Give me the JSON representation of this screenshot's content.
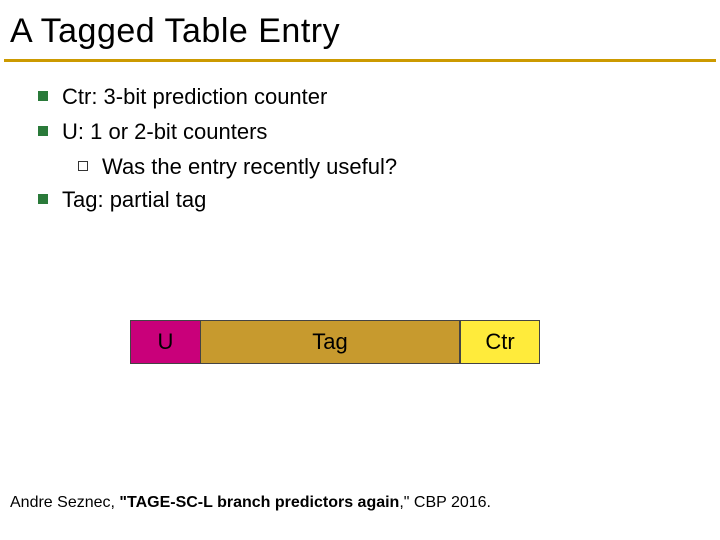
{
  "title": "A Tagged Table Entry",
  "bullets": [
    {
      "text": "Ctr: 3-bit prediction counter"
    },
    {
      "text": "U:   1 or  2-bit counters",
      "sub": [
        {
          "text": "Was the entry recently useful?"
        }
      ]
    },
    {
      "text": "Tag: partial tag"
    }
  ],
  "diagram": {
    "u": "U",
    "tag": "Tag",
    "ctr": "Ctr"
  },
  "citation": {
    "author": "Andre Seznec, ",
    "title": "\"TAGE-SC-L branch predictors again",
    "tail": ",\" CBP 2016."
  }
}
